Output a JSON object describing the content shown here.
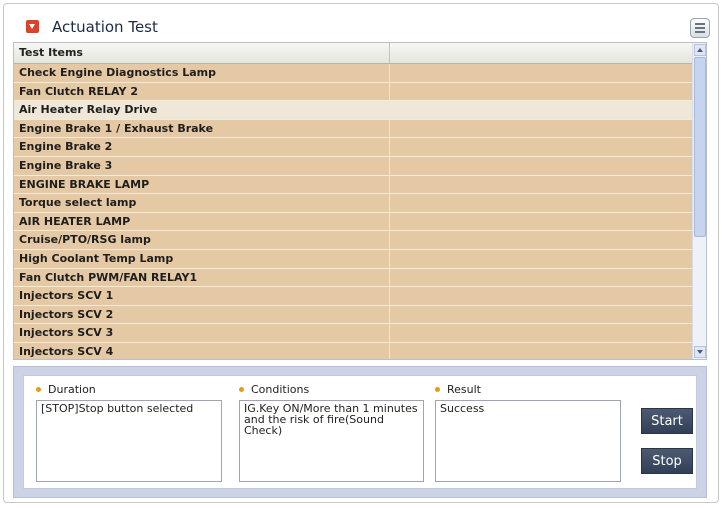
{
  "window": {
    "title": "Actuation Test"
  },
  "table": {
    "headers": [
      "Test Items",
      ""
    ],
    "selected_index": 2,
    "rows": [
      "Check Engine Diagnostics Lamp",
      "Fan Clutch RELAY 2",
      "Air Heater Relay Drive",
      "Engine Brake 1 / Exhaust Brake",
      "Engine Brake 2",
      "Engine Brake 3",
      "ENGINE BRAKE LAMP",
      "Torque select lamp",
      "AIR HEATER LAMP",
      "Cruise/PTO/RSG lamp",
      "High Coolant Temp Lamp",
      "Fan Clutch PWM/FAN RELAY1",
      "Injectors SCV 1",
      "Injectors SCV 2",
      "Injectors SCV 3",
      "Injectors SCV 4"
    ]
  },
  "details": {
    "duration": {
      "label": "Duration",
      "value": "[STOP]Stop button selected"
    },
    "conditions": {
      "label": "Conditions",
      "value": "IG.Key ON/More than 1 minutes and the risk of fire(Sound Check)"
    },
    "result": {
      "label": "Result",
      "value": "Success"
    }
  },
  "buttons": {
    "start": "Start",
    "stop": "Stop"
  },
  "colors": {
    "row_bg": "#e5c9a4",
    "row_selected_bg": "#efe7d8",
    "accent_dot": "#e59a1a",
    "title_icon": "#d8432b",
    "button_bg": "#3d4a62"
  },
  "icons": {
    "title": "collapse-arrow-icon",
    "menu": "menu-icon",
    "scroll_up": "chevron-up-icon",
    "scroll_down": "chevron-down-icon"
  }
}
